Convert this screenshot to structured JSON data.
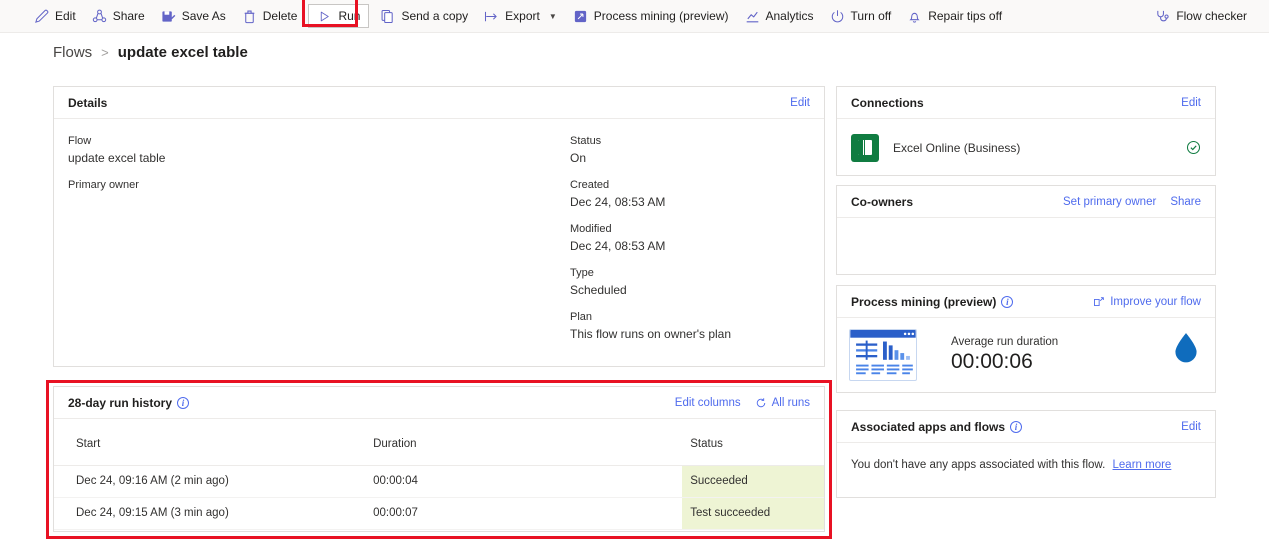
{
  "commandbar": {
    "left_items": [
      {
        "label": "Edit",
        "icon": "pencil-icon"
      },
      {
        "label": "Share",
        "icon": "share-icon"
      },
      {
        "label": "Save As",
        "icon": "save-as-icon"
      },
      {
        "label": "Delete",
        "icon": "trash-icon"
      },
      {
        "label": "Run",
        "icon": "play-icon"
      },
      {
        "label": "Send a copy",
        "icon": "copy-icon"
      },
      {
        "label": "Export",
        "icon": "export-icon"
      },
      {
        "label": "Process mining (preview)",
        "icon": "process-mining-icon"
      },
      {
        "label": "Analytics",
        "icon": "analytics-icon"
      },
      {
        "label": "Turn off",
        "icon": "power-icon"
      },
      {
        "label": "Repair tips off",
        "icon": "bell-icon"
      }
    ],
    "flow_checker": {
      "label": "Flow checker",
      "icon": "stethoscope-icon"
    }
  },
  "breadcrumb": {
    "root": "Flows",
    "separator": ">",
    "current": "update excel table"
  },
  "details": {
    "title": "Details",
    "edit_label": "Edit",
    "left_fields": [
      {
        "label": "Flow",
        "value": "update excel table"
      },
      {
        "label": "Primary owner",
        "value": ""
      }
    ],
    "right_fields": [
      {
        "label": "Status",
        "value": "On"
      },
      {
        "label": "Created",
        "value": "Dec 24, 08:53 AM"
      },
      {
        "label": "Modified",
        "value": "Dec 24, 08:53 AM"
      },
      {
        "label": "Type",
        "value": "Scheduled"
      },
      {
        "label": "Plan",
        "value": "This flow runs on owner's plan"
      }
    ]
  },
  "run_history": {
    "title": "28-day run history",
    "edit_columns_label": "Edit columns",
    "all_runs_label": "All runs",
    "columns": [
      "Start",
      "Duration",
      "Status"
    ],
    "rows": [
      {
        "start": "Dec 24, 09:16 AM (2 min ago)",
        "duration": "00:00:04",
        "status": "Succeeded"
      },
      {
        "start": "Dec 24, 09:15 AM (3 min ago)",
        "duration": "00:00:07",
        "status": "Test succeeded"
      }
    ]
  },
  "connections": {
    "title": "Connections",
    "edit_label": "Edit",
    "items": [
      {
        "name": "Excel Online (Business)",
        "icon": "excel-icon",
        "status": "connected"
      }
    ]
  },
  "co_owners": {
    "title": "Co-owners",
    "set_primary_owner_label": "Set primary owner",
    "share_label": "Share"
  },
  "process_mining": {
    "title": "Process mining (preview)",
    "improve_label": "Improve your flow",
    "metric_label": "Average run duration",
    "metric_value": "00:00:06"
  },
  "associated": {
    "title": "Associated apps and flows",
    "edit_label": "Edit",
    "body_text": "You don't have any apps associated with this flow.",
    "learn_more_label": "Learn more"
  },
  "colors": {
    "accent_link": "#4f6bed",
    "icon_purple": "#6264c7",
    "highlight_red": "#e81123",
    "status_cell_bg": "#eef4d4",
    "excel_green": "#107c41",
    "drop_blue": "#0f6cbd"
  }
}
